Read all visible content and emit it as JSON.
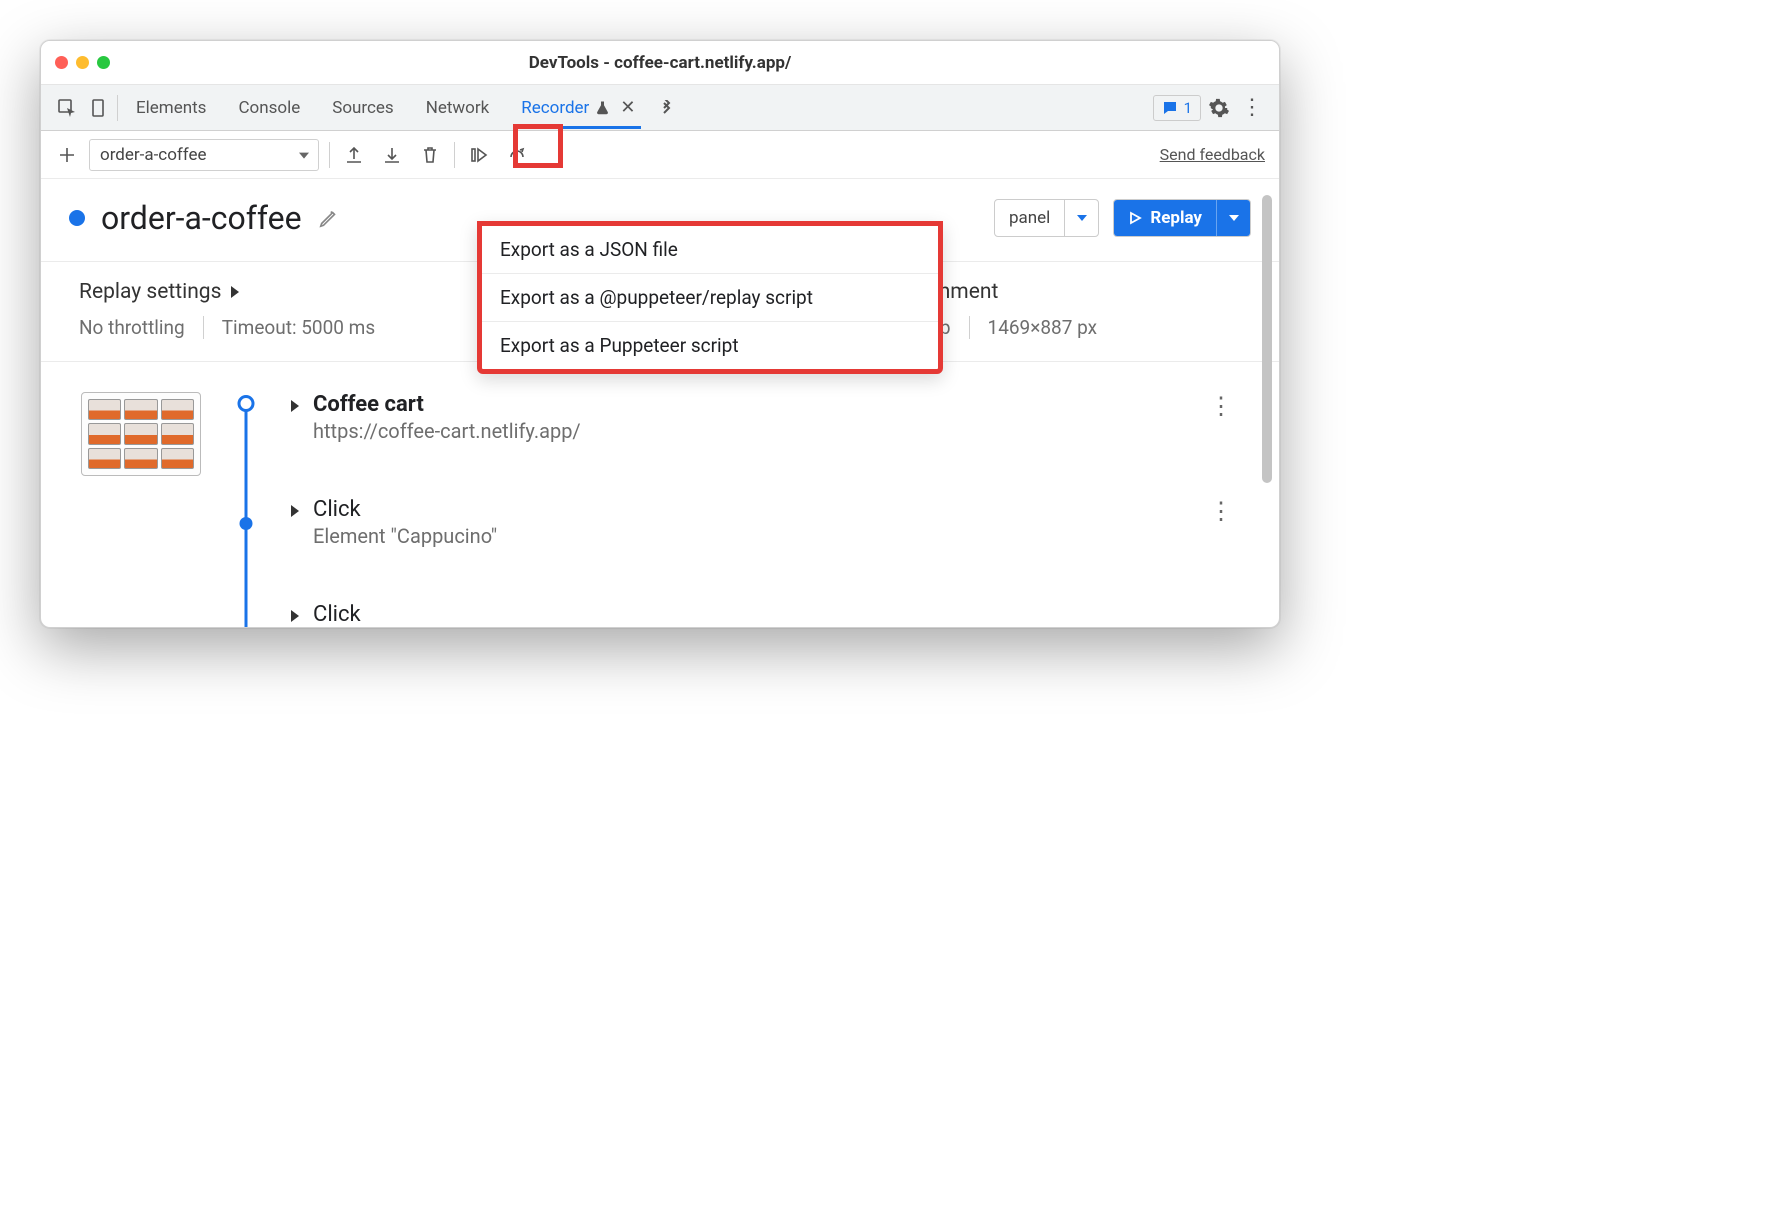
{
  "window": {
    "title": "DevTools - coffee-cart.netlify.app/"
  },
  "tabs": {
    "items": [
      "Elements",
      "Console",
      "Sources",
      "Network",
      "Recorder"
    ],
    "messages_count": "1"
  },
  "feedback_link": "Send feedback",
  "recording_selector": "order-a-coffee",
  "recording_title": "order-a-coffee",
  "panel_button_label": "panel",
  "replay_button_label": "Replay",
  "export_menu": [
    "Export as a JSON file",
    "Export as a @puppeteer/replay script",
    "Export as a Puppeteer script"
  ],
  "replay_settings": {
    "title": "Replay settings",
    "throttling": "No throttling",
    "timeout": "Timeout: 5000 ms"
  },
  "environment": {
    "title": "Environment",
    "device": "Desktop",
    "viewport": "1469×887 px"
  },
  "steps": [
    {
      "title": "Coffee cart",
      "sub": "https://coffee-cart.netlify.app/"
    },
    {
      "title": "Click",
      "sub": "Element \"Cappucino\""
    },
    {
      "title": "Click",
      "sub": ""
    }
  ]
}
